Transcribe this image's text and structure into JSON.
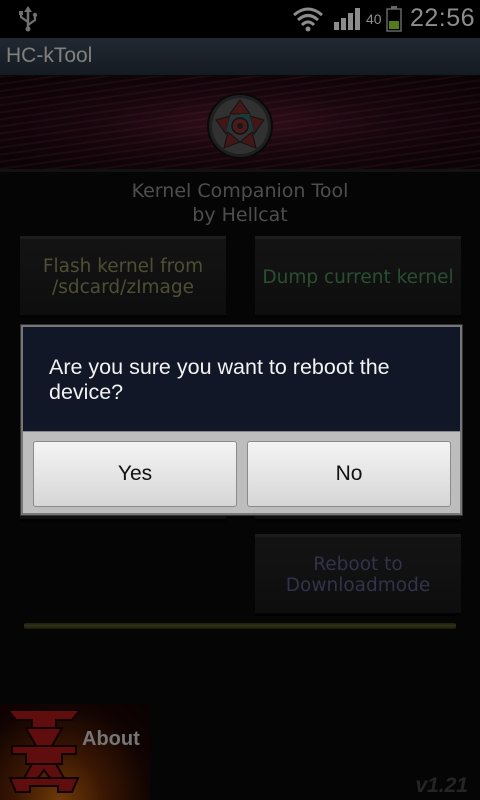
{
  "status_bar": {
    "usb_icon": "usb-icon",
    "wifi_icon": "wifi-icon",
    "signal_icon": "signal-icon",
    "battery_level": "40",
    "battery_icon": "battery-icon",
    "clock": "22:56"
  },
  "app": {
    "title": "HC-kTool"
  },
  "header": {
    "line1": "Kernel Companion Tool",
    "line2": "by Hellcat"
  },
  "tools": {
    "flash_label": "Flash kernel from /sdcard/zImage",
    "dump_label": "Dump current kernel",
    "download_label": "Reboot to Downloadmode"
  },
  "about": {
    "label": "About"
  },
  "version": "v1.21",
  "dialog": {
    "message": "Are you sure you want to reboot the device?",
    "yes_label": "Yes",
    "no_label": "No"
  },
  "colors": {
    "title_bar": "#2f3a49",
    "dialog_message_bg": "#111726",
    "dialog_button_bar": "#bdbdbd",
    "flash_text": "#8f8f60",
    "dump_text": "#4e8e5a",
    "download_text": "#5b5b8a"
  }
}
